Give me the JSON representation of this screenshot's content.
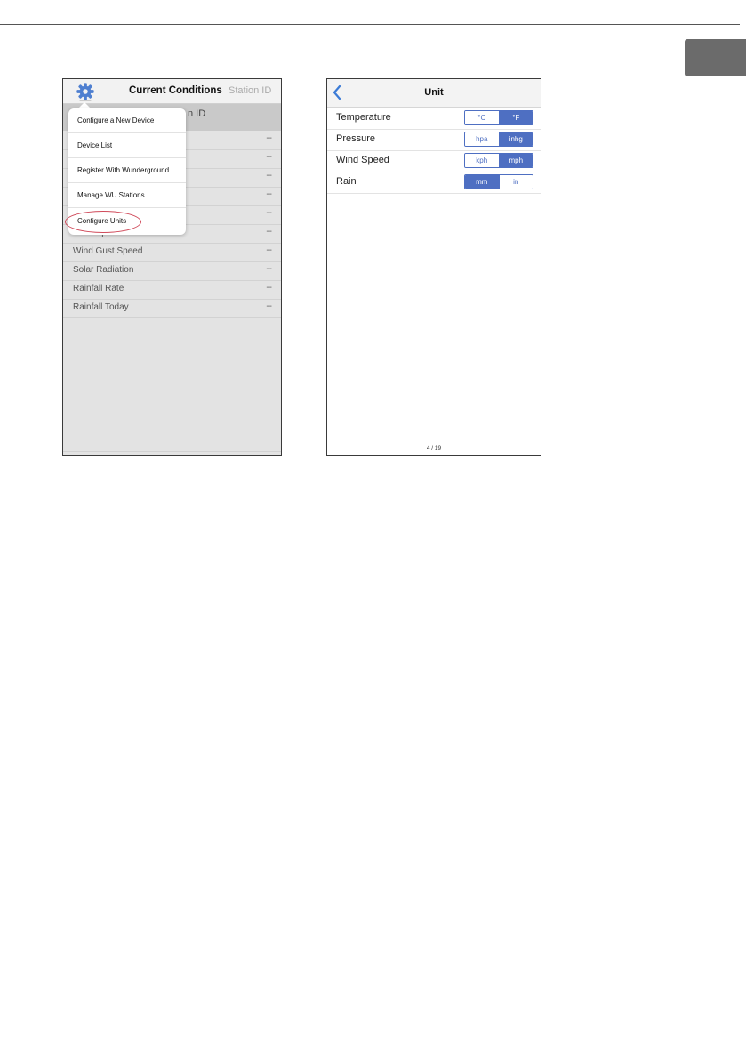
{
  "left_screen": {
    "header": {
      "title": "Current Conditions",
      "station_tab": "Station ID"
    },
    "subheader": "n ID",
    "rows": [
      {
        "label": "",
        "value": "--"
      },
      {
        "label": "",
        "value": "--"
      },
      {
        "label": "",
        "value": "--"
      },
      {
        "label": "",
        "value": "--"
      },
      {
        "label": "",
        "value": "--"
      },
      {
        "label": "Wind Speed",
        "value": "--"
      },
      {
        "label": "Wind Gust Speed",
        "value": "--"
      },
      {
        "label": "Solar Radiation",
        "value": "--"
      },
      {
        "label": "Rainfall Rate",
        "value": "--"
      },
      {
        "label": "Rainfall Today",
        "value": "--"
      }
    ],
    "menu": [
      "Configure a New Device",
      "Device List",
      "Register With Wunderground",
      "Manage WU Stations",
      "Configure Units"
    ],
    "highlighted_item": "Configure Units"
  },
  "right_screen": {
    "title": "Unit",
    "settings": [
      {
        "label": "Temperature",
        "options": [
          "°C",
          "°F"
        ],
        "selected": 1
      },
      {
        "label": "Pressure",
        "options": [
          "hpa",
          "inhg"
        ],
        "selected": 1
      },
      {
        "label": "Wind Speed",
        "options": [
          "kph",
          "mph"
        ],
        "selected": 1
      },
      {
        "label": "Rain",
        "options": [
          "mm",
          "in"
        ],
        "selected": 0
      }
    ],
    "page_indicator": "4 / 19"
  },
  "colors": {
    "accent": "#4e6fc2",
    "highlight_circle": "#d04a5a",
    "side_tab": "#6b6b6b"
  }
}
